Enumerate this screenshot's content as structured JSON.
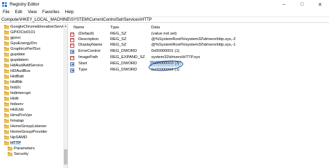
{
  "window": {
    "title": "Registry Editor",
    "controls": [
      "–",
      "□",
      "✕"
    ]
  },
  "menu": [
    "File",
    "Edit",
    "View",
    "Favorites",
    "Help"
  ],
  "address": "Computer\\HKEY_LOCAL_MACHINE\\SYSTEM\\CurrentControlSet\\Services\\HTTP",
  "tree": {
    "items": [
      "GoogleChromeElevationServi",
      "GPIOClx0101",
      "gpsvc",
      "GpuEnergyDrv",
      "GraphicsPerfSvc",
      "gupdate",
      "gupdatem",
      "HdAudAddService",
      "HDAudBus",
      "HidBatt",
      "HidBth",
      "hidi2c",
      "hidinterrupt",
      "HidIr",
      "hidserv",
      "HidUsb",
      "HmsProVpn",
      "hmatap",
      "HomeGroupListener",
      "HomeGroupProvider",
      "HpSAMD",
      "HTTP"
    ],
    "selected": "HTTP",
    "children": [
      "Parameters",
      "Security"
    ]
  },
  "columns": {
    "name": "Name",
    "type": "Type",
    "data": "Data"
  },
  "values": [
    {
      "name": "(Default)",
      "type": "REG_SZ",
      "data": "(value not set)",
      "kind": "sz"
    },
    {
      "name": "Description",
      "type": "REG_SZ",
      "data": "@%SystemRoot%\\system32\\drivers\\http.sys,-2",
      "kind": "sz"
    },
    {
      "name": "DisplayName",
      "type": "REG_SZ",
      "data": "@%SystemRoot%\\system32\\drivers\\http.sys,-1",
      "kind": "sz"
    },
    {
      "name": "ErrorControl",
      "type": "REG_DWORD",
      "data": "0x00000001 (1)",
      "kind": "dw"
    },
    {
      "name": "ImagePath",
      "type": "REG_EXPAND_SZ",
      "data": "system32\\drivers\\HTTP.sys",
      "kind": "sz"
    },
    {
      "name": "Start",
      "type": "REG_DWORD",
      "data": "0x00000003 (3)",
      "kind": "dw",
      "highlight": true
    },
    {
      "name": "Type",
      "type": "REG_DWORD",
      "data": "0x00000001 (1)",
      "kind": "dw"
    }
  ],
  "colors": {
    "selection": "#cce8ff",
    "folder": "#e8c25a",
    "annotation": "#1a3aa0"
  }
}
